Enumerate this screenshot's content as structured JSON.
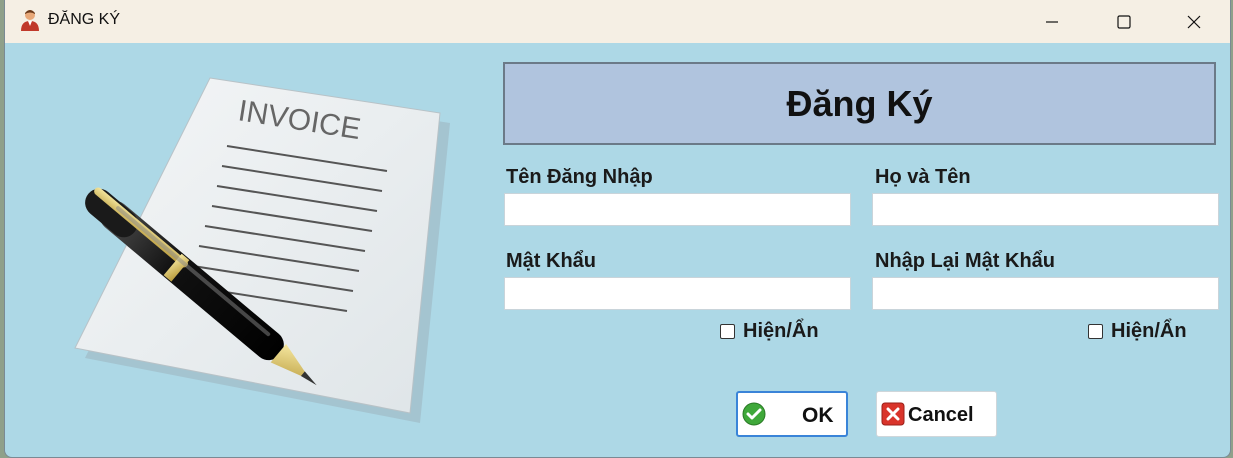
{
  "window": {
    "title": "ĐĂNG KÝ",
    "icon": "user-icon",
    "controls": [
      "minimize-icon",
      "maximize-icon",
      "close-icon"
    ]
  },
  "illustration": {
    "text": "INVOICE"
  },
  "form": {
    "heading": "Đăng Ký",
    "username": {
      "label": "Tên Đăng Nhập",
      "value": ""
    },
    "fullname": {
      "label": "Họ và Tên",
      "value": ""
    },
    "password": {
      "label": "Mật Khẩu",
      "value": ""
    },
    "confirm_password": {
      "label": "Nhập Lại Mật Khẩu",
      "value": ""
    },
    "show_password_label": "Hiện/Ẩn",
    "show_confirm_label": "Hiện/Ẩn"
  },
  "buttons": {
    "ok": {
      "label": "OK",
      "icon": "checkmark-icon"
    },
    "cancel": {
      "label": "Cancel",
      "icon": "cancel-x-icon"
    }
  },
  "colors": {
    "background": "#add8e6",
    "header": "#b0c4de",
    "titlebar": "#f5efe4"
  }
}
